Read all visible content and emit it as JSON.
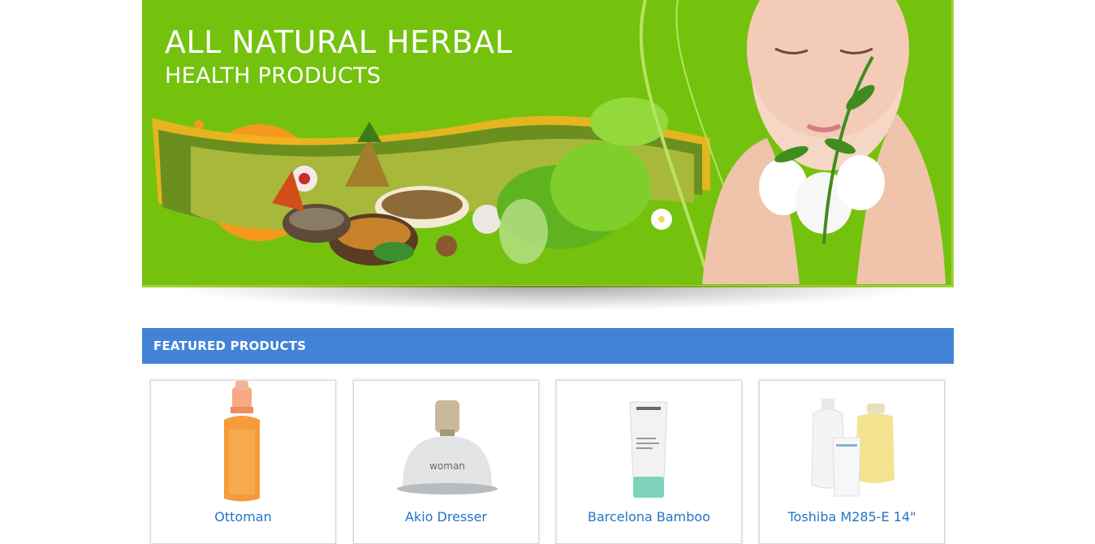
{
  "banner": {
    "title_line1": "ALL NATURAL HERBAL",
    "title_line2": "HEALTH PRODUCTS"
  },
  "featured": {
    "heading": "FEATURED PRODUCTS",
    "products": [
      {
        "name": "Ottoman",
        "label": ""
      },
      {
        "name": "Akio Dresser",
        "label": "woman"
      },
      {
        "name": "Barcelona Bamboo",
        "label": ""
      },
      {
        "name": "Toshiba M285-E 14\"",
        "label": ""
      }
    ]
  },
  "colors": {
    "banner_green": "#74c20e",
    "featured_blue": "#4383d7",
    "link_blue": "#2276c4"
  }
}
